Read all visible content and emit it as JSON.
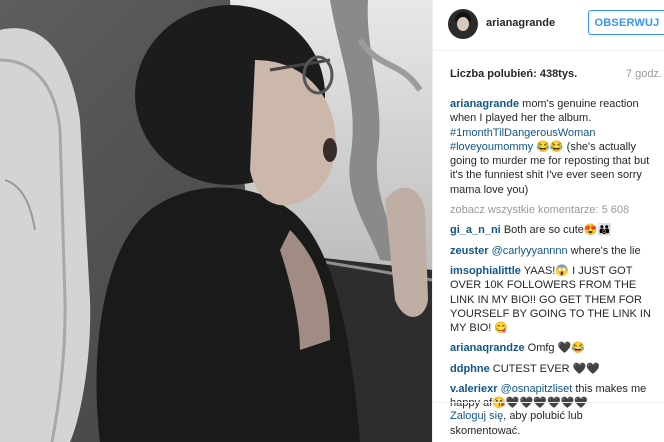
{
  "post": {
    "username": "arianagrande",
    "follow_label": "OBSERWUJ",
    "likes": "Liczba polubień: 438tys.",
    "time": "7 godz.",
    "caption": {
      "user": "arianagrande",
      "text1": "mom's genuine reaction when I played her the album.",
      "tag1": "#1monthTilDangerousWoman",
      "tag2": "#loveyoumommy",
      "text2": "😂😂 (she's actually going to murder me for reposting that but it's the funniest shit I've ever seen sorry mama love you)"
    },
    "view_all": "zobacz wszystkie komentarze: 5 608",
    "comments": [
      {
        "user": "gi_a_n_ni",
        "text": "Both are so cute😍👪"
      },
      {
        "user": "zeuster",
        "mention": "@carlyyyannnn",
        "text": "where's the lie"
      },
      {
        "user": "imsophialittle",
        "text": "YAAS!😱 I JUST GOT OVER 10K FOLLOWERS FROM THE LINK IN MY BIO!! GO GET THEM FOR YOURSELF BY GOING TO THE LINK IN MY BIO! 😋"
      },
      {
        "user": "arianaqrandze",
        "text": "Omfg 🖤😂"
      },
      {
        "user": "ddphne",
        "text": "CUTEST EVER 🖤🖤"
      },
      {
        "user": "v.alerieхr",
        "mention": "@osnapitzliset",
        "text": "this makes me happy af😘🖤🖤🖤🖤🖤🖤"
      }
    ],
    "footer": {
      "login_link": "Zaloguj się",
      "text": ", aby polubić lub skomentować."
    }
  }
}
